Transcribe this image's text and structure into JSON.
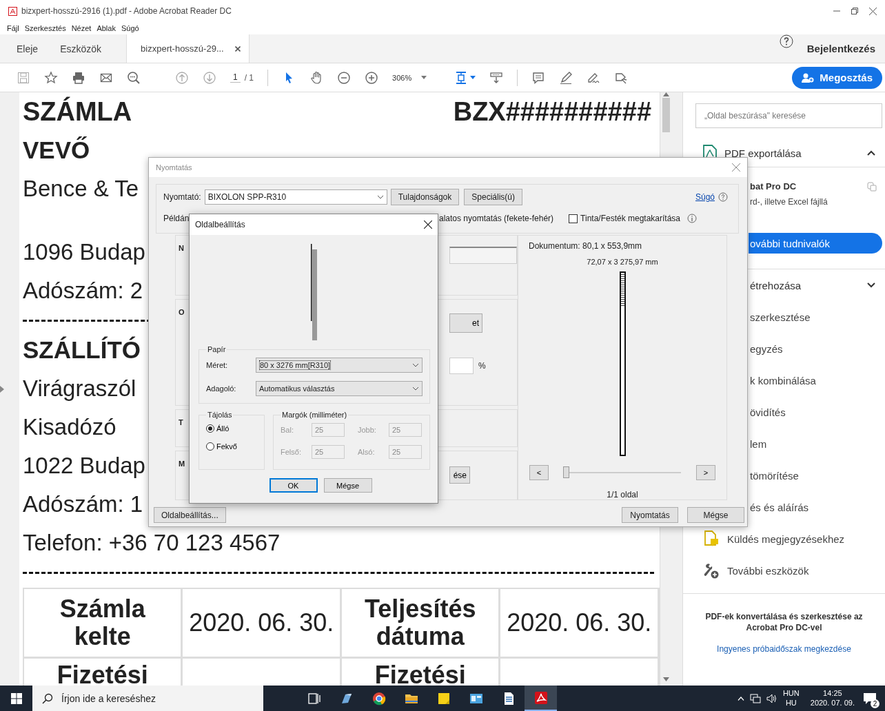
{
  "window": {
    "title": "bizxpert-hosszú-2916 (1).pdf - Adobe Acrobat Reader DC"
  },
  "menu": [
    "Fájl",
    "Szerkesztés",
    "Nézet",
    "Ablak",
    "Súgó"
  ],
  "tabs": [
    {
      "label": "Eleje",
      "selected": false,
      "kind": "nav"
    },
    {
      "label": "Eszközök",
      "selected": false,
      "kind": "nav"
    },
    {
      "label": "bizxpert-hosszú-29...",
      "selected": true,
      "kind": "document"
    }
  ],
  "sign_in": "Bejelentkezés",
  "toolbar": {
    "page": "1",
    "page_count": "/ 1",
    "zoom": "306%",
    "share": "Megosztás"
  },
  "document": {
    "title": "SZÁMLA",
    "number": "BZX##########",
    "lines": [
      {
        "kind": "heading",
        "text": "VEVŐ"
      },
      {
        "kind": "text",
        "text": "Bence & Te"
      },
      {
        "kind": "blank"
      },
      {
        "kind": "text",
        "text": "1096 Budap"
      },
      {
        "kind": "text",
        "text": "Adószám: 2"
      },
      {
        "kind": "divider"
      },
      {
        "kind": "heading",
        "text": "SZÁLLÍTÓ"
      },
      {
        "kind": "text",
        "text": "Virágraszól"
      },
      {
        "kind": "text",
        "text": "Kisadózó"
      },
      {
        "kind": "text",
        "text": "1022 Budap"
      },
      {
        "kind": "text",
        "text": "Adószám: 1"
      },
      {
        "kind": "text",
        "text": "Telefon: +36 70 123 4567"
      },
      {
        "kind": "divider"
      }
    ],
    "table": [
      [
        {
          "kind": "label",
          "text": "Számla kelte"
        },
        {
          "kind": "value",
          "text": "2020. 06. 30."
        },
        {
          "kind": "label",
          "text": "Teljesítés dátuma"
        },
        {
          "kind": "value",
          "text": "2020. 06. 30."
        }
      ],
      [
        {
          "kind": "label",
          "text": "Fizetési"
        },
        {
          "kind": "hidden"
        },
        {
          "kind": "label",
          "text": "Fizetési"
        },
        {
          "kind": "hidden"
        }
      ]
    ]
  },
  "right_panel": {
    "search_placeholder": "„Oldal beszúrása\" keresése",
    "export": {
      "title": "PDF exportálása",
      "expanded": true
    },
    "promo_title": "bat Pro DC",
    "promo_text": "rd-, illetve Excel fájllá",
    "promo_button": "ovábbi tudnivalók",
    "create": {
      "title": "étrehozása",
      "expanded": false
    },
    "hidden_tools": [
      "szerkesztése",
      "egyzés",
      "k kombinálása",
      "övidítés",
      "lem",
      "tömörítése",
      "és és aláírás"
    ],
    "tools": [
      {
        "kind": "comment",
        "label": "Küldés megjegyzésekhez"
      },
      {
        "kind": "more",
        "label": "További eszközök"
      }
    ],
    "footer": "PDF-ek konvertálása és szerkesztése az Acrobat Pro DC-vel",
    "footer_link": "Ingyenes próbaidőszak megkezdése"
  },
  "print_dialog": {
    "title": "Nyomtatás",
    "printer_label": "Nyomtató:",
    "printer": "BIXOLON SPP-R310",
    "properties_button": "Tulajdonságok",
    "advanced_button": "Speciális(ú)",
    "help_link": "Súgó",
    "copies_label": "Példán",
    "grayscale_label": "alatos nyomtatás (fekete-fehér)",
    "save_ink": {
      "label": "Tinta/Festék megtakarítása",
      "checked": false
    },
    "sections": [
      {
        "kind": "field",
        "label": "N"
      },
      {
        "kind": "options",
        "label": "O",
        "button": "et",
        "unit": "%"
      },
      {
        "kind": "plain",
        "label": "T"
      },
      {
        "kind": "button",
        "label": "M",
        "button": "ése"
      }
    ],
    "preview": {
      "document_size": "Dokumentum: 80,1 x 553,9mm",
      "paper_size": "72,07 x 3 275,97 mm",
      "prev": "<",
      "next": ">",
      "slider": {
        "level": 0.02
      },
      "page_info": "1/1 oldal"
    },
    "page_setup_button": "Oldalbeállítás...",
    "print_button": "Nyomtatás",
    "cancel_button": "Mégse"
  },
  "page_setup": {
    "title": "Oldalbeállítás",
    "paper_group": "Papír",
    "size_label": "Méret:",
    "size": "80 x 3276 mm[R310]",
    "source_label": "Adagoló:",
    "source": "Automatikus választás",
    "orientation_group": "Tájolás",
    "orientations": [
      {
        "label": "Álló",
        "selected": true
      },
      {
        "label": "Fekvő",
        "selected": false
      }
    ],
    "margins_group": "Margók (milliméter)",
    "margins": [
      {
        "label": "Bal:",
        "value": "25",
        "disabled": true
      },
      {
        "label": "Jobb:",
        "value": "25",
        "disabled": true
      },
      {
        "label": "Felső:",
        "value": "25",
        "disabled": true
      },
      {
        "label": "Alsó:",
        "value": "25",
        "disabled": true
      }
    ],
    "ok": "OK",
    "cancel": "Mégse"
  },
  "taskbar": {
    "search_placeholder": "Írjon ide a kereséshez",
    "language": "HUN",
    "layout": "HU",
    "time": "14:25",
    "date": "2020. 07. 09.",
    "notifications": "2"
  }
}
